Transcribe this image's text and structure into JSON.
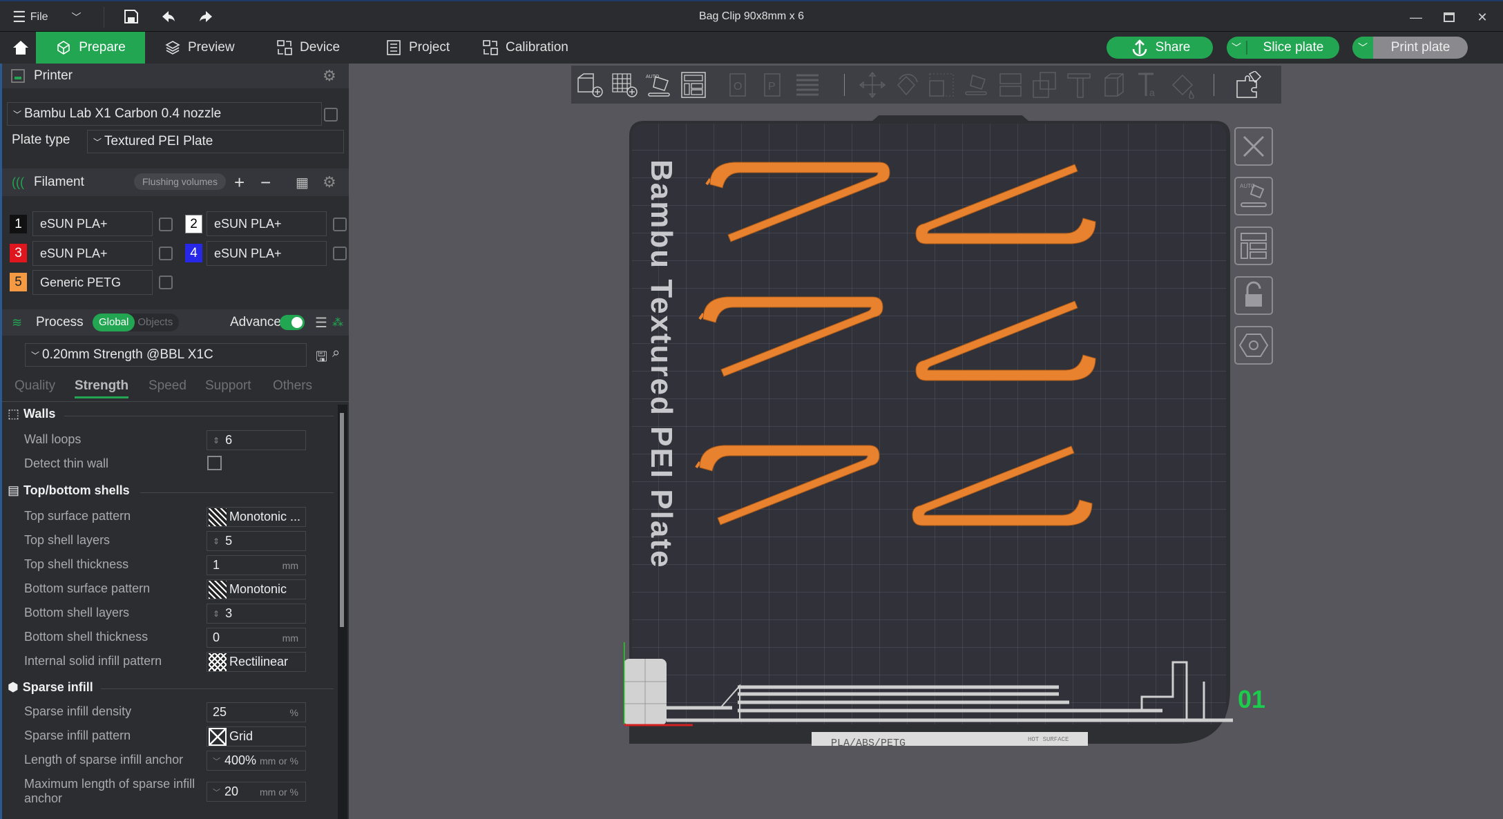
{
  "window": {
    "title": "Bag Clip 90x8mm x 6",
    "file_menu": "File"
  },
  "nav": {
    "tabs": [
      {
        "label": "Prepare",
        "active": true
      },
      {
        "label": "Preview"
      },
      {
        "label": "Device"
      },
      {
        "label": "Project"
      },
      {
        "label": "Calibration"
      }
    ],
    "share": "Share",
    "slice": "Slice plate",
    "print": "Print plate"
  },
  "printer": {
    "header": "Printer",
    "preset": "Bambu Lab X1 Carbon 0.4 nozzle",
    "plate_type_label": "Plate type",
    "plate_type": "Textured PEI Plate"
  },
  "filament": {
    "header": "Filament",
    "flushing": "Flushing volumes",
    "items": [
      {
        "num": "1",
        "name": "eSUN PLA+",
        "color": "#111111"
      },
      {
        "num": "2",
        "name": "eSUN PLA+",
        "color": "#ffffff"
      },
      {
        "num": "3",
        "name": "eSUN PLA+",
        "color": "#e0161e"
      },
      {
        "num": "4",
        "name": "eSUN PLA+",
        "color": "#2727e8"
      },
      {
        "num": "5",
        "name": "Generic PETG",
        "color": "#f59a42"
      }
    ]
  },
  "process": {
    "header": "Process",
    "global": "Global",
    "objects": "Objects",
    "advance": "Advance",
    "advance_on": true,
    "preset": "0.20mm Strength @BBL X1C",
    "tabs": [
      "Quality",
      "Strength",
      "Speed",
      "Support",
      "Others"
    ],
    "active_tab": "Strength"
  },
  "settings": {
    "walls": {
      "title": "Walls",
      "wall_loops_label": "Wall loops",
      "wall_loops": "6",
      "detect_thin_label": "Detect thin wall",
      "detect_thin": false
    },
    "shells": {
      "title": "Top/bottom shells",
      "top_pattern_label": "Top surface pattern",
      "top_pattern": "Monotonic ...",
      "top_layers_label": "Top shell layers",
      "top_layers": "5",
      "top_thick_label": "Top shell thickness",
      "top_thick": "1",
      "unit_mm": "mm",
      "bottom_pattern_label": "Bottom surface pattern",
      "bottom_pattern": "Monotonic",
      "bottom_layers_label": "Bottom shell layers",
      "bottom_layers": "3",
      "bottom_thick_label": "Bottom shell thickness",
      "bottom_thick": "0",
      "internal_label": "Internal solid infill pattern",
      "internal": "Rectilinear"
    },
    "sparse": {
      "title": "Sparse infill",
      "density_label": "Sparse infill density",
      "density": "25",
      "unit_pct": "%",
      "pattern_label": "Sparse infill pattern",
      "pattern": "Grid",
      "anchor_label": "Length of sparse infill anchor",
      "anchor": "400%",
      "unit_mmpct": "mm or %",
      "max_anchor_label": "Maximum length of sparse infill anchor",
      "max_anchor": "20"
    }
  },
  "viewport": {
    "plate_text": "Bambu Textured PEI Plate",
    "plate_number": "01",
    "plate_label": "PLA/ABS/PETG",
    "hot_surface": "HOT SURFACE",
    "object_color": "#e8822e",
    "accent": "#22a652"
  }
}
